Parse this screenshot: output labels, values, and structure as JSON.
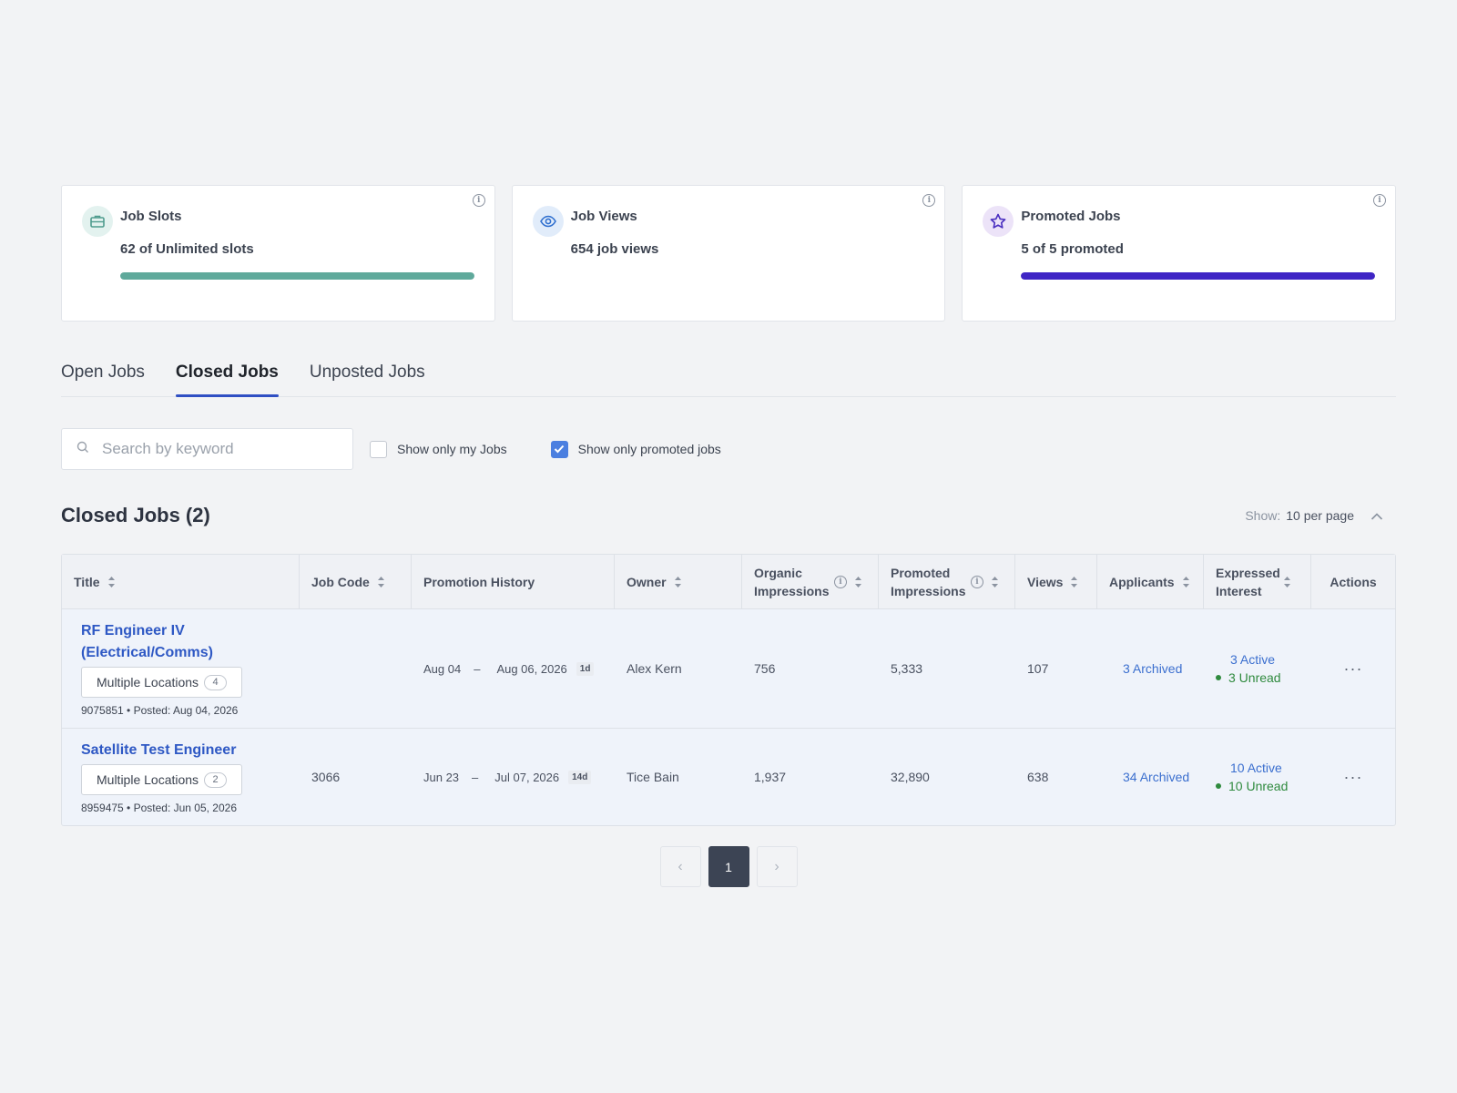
{
  "stats": [
    {
      "title": "Job Slots",
      "value": "62 of Unlimited slots",
      "icon": "briefcase-icon",
      "accent": "#5fa99b",
      "progress": 1.0
    },
    {
      "title": "Job Views",
      "value": "654 job views",
      "icon": "eye-icon",
      "accent": "#2f6fcf"
    },
    {
      "title": "Promoted Jobs",
      "value": "5 of 5 promoted",
      "icon": "star-icon",
      "accent": "#3f25c5",
      "progress": 1.0
    }
  ],
  "tabs": [
    "Open Jobs",
    "Closed Jobs",
    "Unposted Jobs"
  ],
  "active_tab": "Closed Jobs",
  "filters": {
    "search_placeholder": "Search by keyword",
    "show_my_jobs_label": "Show only my Jobs",
    "show_my_jobs_checked": false,
    "show_promoted_label": "Show only promoted jobs",
    "show_promoted_checked": true
  },
  "section": {
    "title": "Closed Jobs (2)",
    "show_label": "Show:",
    "per_page": "10 per page"
  },
  "table": {
    "columns": [
      "Title",
      "Job Code",
      "Promotion History",
      "Owner",
      "Organic Impressions",
      "Promoted Impressions",
      "Views",
      "Applicants",
      "Expressed Interest",
      "Actions"
    ],
    "rows": [
      {
        "title": "RF Engineer IV (Electrical/Comms)",
        "locations_label": "Multiple Locations",
        "locations_count": "4",
        "meta": "9075851 • Posted: Aug 04, 2026",
        "job_code": "",
        "promo_start": "Aug 04",
        "promo_end": "Aug 06, 2026",
        "promo_duration": "1d",
        "owner": "Alex Kern",
        "organic": "756",
        "promoted": "5,333",
        "views": "107",
        "applicants": "3 Archived",
        "interest_active": "3 Active",
        "interest_unread": "3 Unread"
      },
      {
        "title": "Satellite Test Engineer",
        "locations_label": "Multiple Locations",
        "locations_count": "2",
        "meta": "8959475 • Posted: Jun 05, 2026",
        "job_code": "3066",
        "promo_start": "Jun 23",
        "promo_end": "Jul 07, 2026",
        "promo_duration": "14d",
        "owner": "Tice Bain",
        "organic": "1,937",
        "promoted": "32,890",
        "views": "638",
        "applicants": "34 Archived",
        "interest_active": "10 Active",
        "interest_unread": "10 Unread"
      }
    ],
    "promo_separator": "–",
    "actions_glyph": "···"
  },
  "pagination": {
    "prev": "‹",
    "current": "1",
    "next": "›"
  }
}
